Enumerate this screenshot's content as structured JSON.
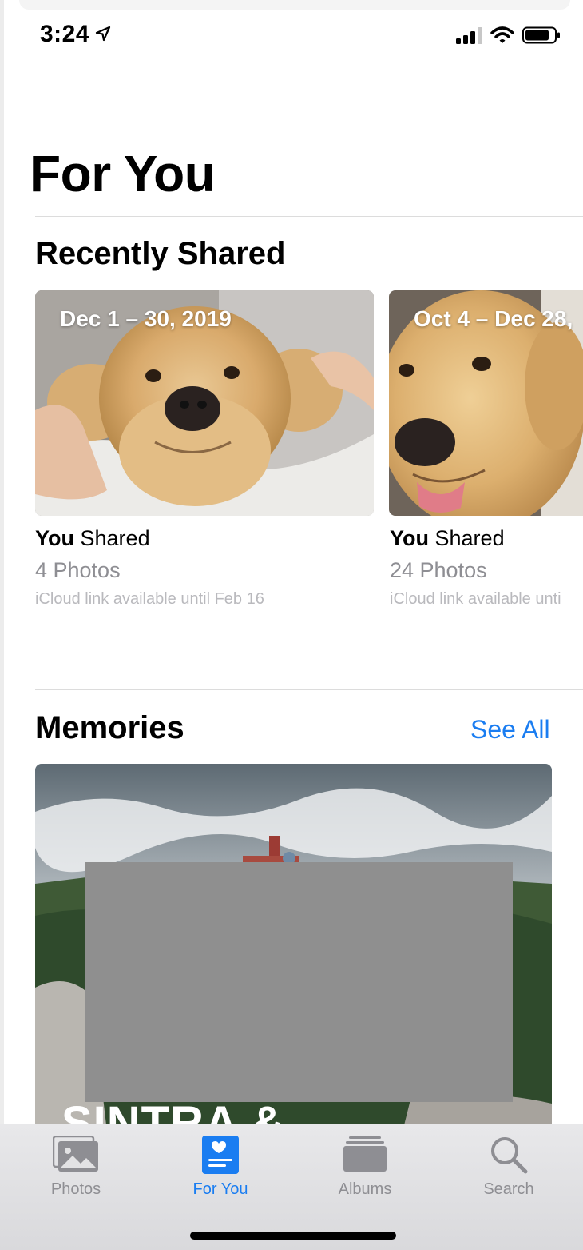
{
  "status_bar": {
    "time": "3:24"
  },
  "page": {
    "title": "For You"
  },
  "recently_shared": {
    "heading": "Recently Shared",
    "cards": [
      {
        "date": "Dec 1 – 30, 2019",
        "sharer": "You",
        "action": "Shared",
        "count": "4 Photos",
        "note": "iCloud link available until Feb 16"
      },
      {
        "date": "Oct 4 – Dec 28,",
        "sharer": "You",
        "action": "Shared",
        "count": "24 Photos",
        "note": "iCloud link available unti"
      }
    ]
  },
  "memories": {
    "heading": "Memories",
    "see_all": "See All",
    "featured": {
      "title": "SINTRA &"
    }
  },
  "tab_bar": {
    "active": "For You",
    "tabs": [
      {
        "label": "Photos",
        "icon": "photos-icon"
      },
      {
        "label": "For You",
        "icon": "for-you-icon"
      },
      {
        "label": "Albums",
        "icon": "albums-icon"
      },
      {
        "label": "Search",
        "icon": "search-icon"
      }
    ]
  },
  "colors": {
    "accent": "#1a7df1",
    "secondary_text": "#8e8e93",
    "tertiary_text": "#b9b9bd"
  }
}
